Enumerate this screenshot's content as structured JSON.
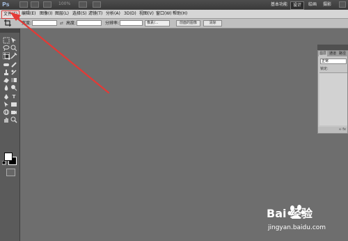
{
  "app": {
    "logo": "Ps",
    "zoom_label": "100%"
  },
  "workspace": {
    "items": [
      "基本功能",
      "设计",
      "绘画",
      "摄影"
    ],
    "active": "设计"
  },
  "menu": {
    "items": [
      "文件(F)",
      "编辑(E)",
      "图像(I)",
      "图层(L)",
      "选择(S)",
      "滤镜(T)",
      "分析(A)",
      "3D(D)",
      "视图(V)",
      "窗口(W)",
      "帮助(H)"
    ]
  },
  "options": {
    "width_label": "宽度:",
    "height_label": "高度:",
    "resolution_label": "分辨率:",
    "unit_select": "像素/...",
    "front_image_button": "前面的图像",
    "clear_button": "清除"
  },
  "layers_panel": {
    "tabs": [
      "图层",
      "通道",
      "路径"
    ],
    "blend_mode": "正常",
    "lock_label": "锁定:",
    "footer": "∞ fx"
  },
  "colors": {
    "annotation": "#e53935",
    "ui_dark": "#3a3a3a",
    "canvas": "#6e6e6e"
  },
  "watermark": {
    "logo": "Bai 经验",
    "url": "jingyan.baidu.com"
  }
}
